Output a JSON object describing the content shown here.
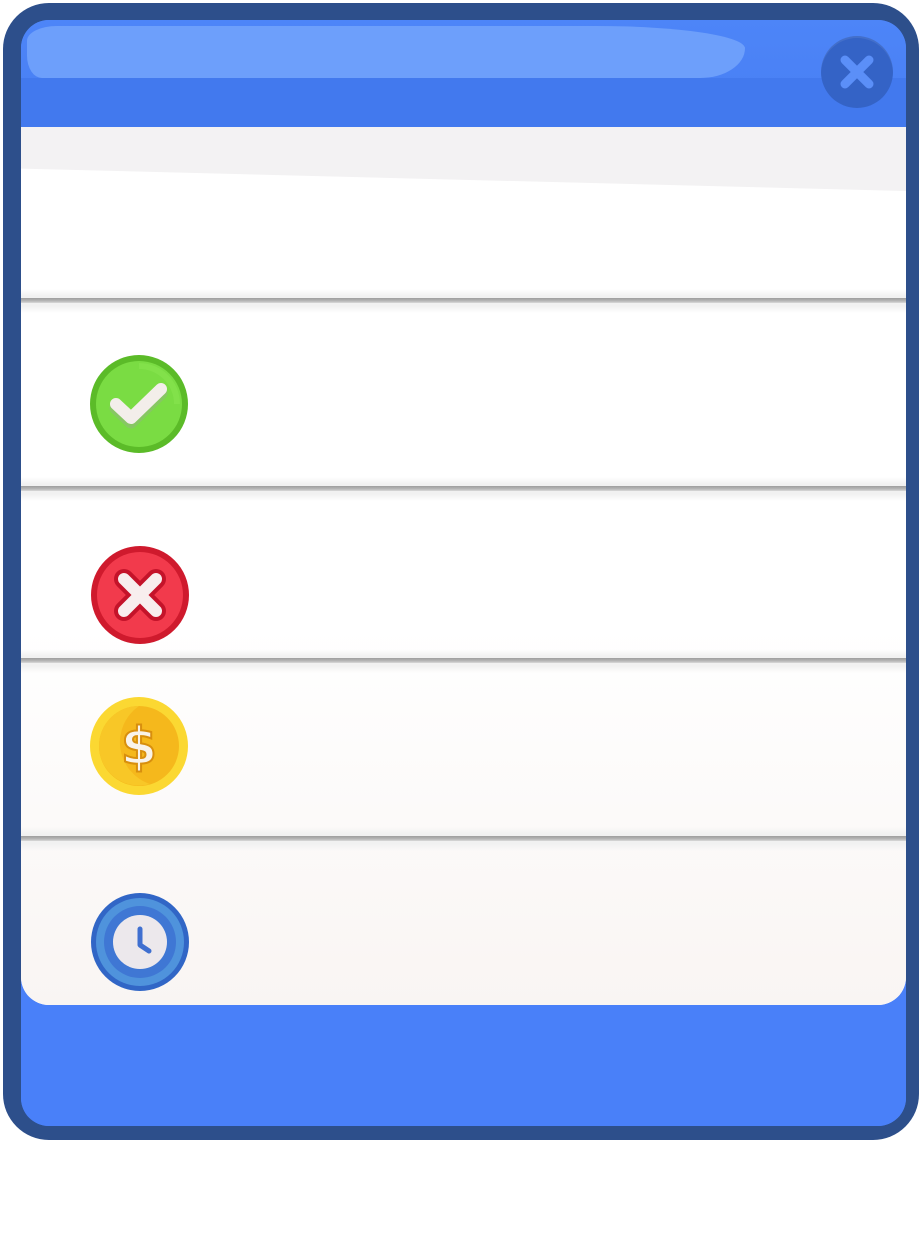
{
  "window": {
    "close_icon": "close-icon",
    "colors": {
      "frame": "#2d4f8b",
      "header": "#4980f9",
      "close_button": "#3463c6",
      "panel": "#ffffff"
    }
  },
  "rows": [
    {
      "icon": "check-icon",
      "color": "#6fcf34"
    },
    {
      "icon": "cross-icon",
      "color": "#e8243c"
    },
    {
      "icon": "dollar-coin-icon",
      "color": "#f6c51e"
    },
    {
      "icon": "clock-icon",
      "color": "#3f78d6"
    }
  ]
}
